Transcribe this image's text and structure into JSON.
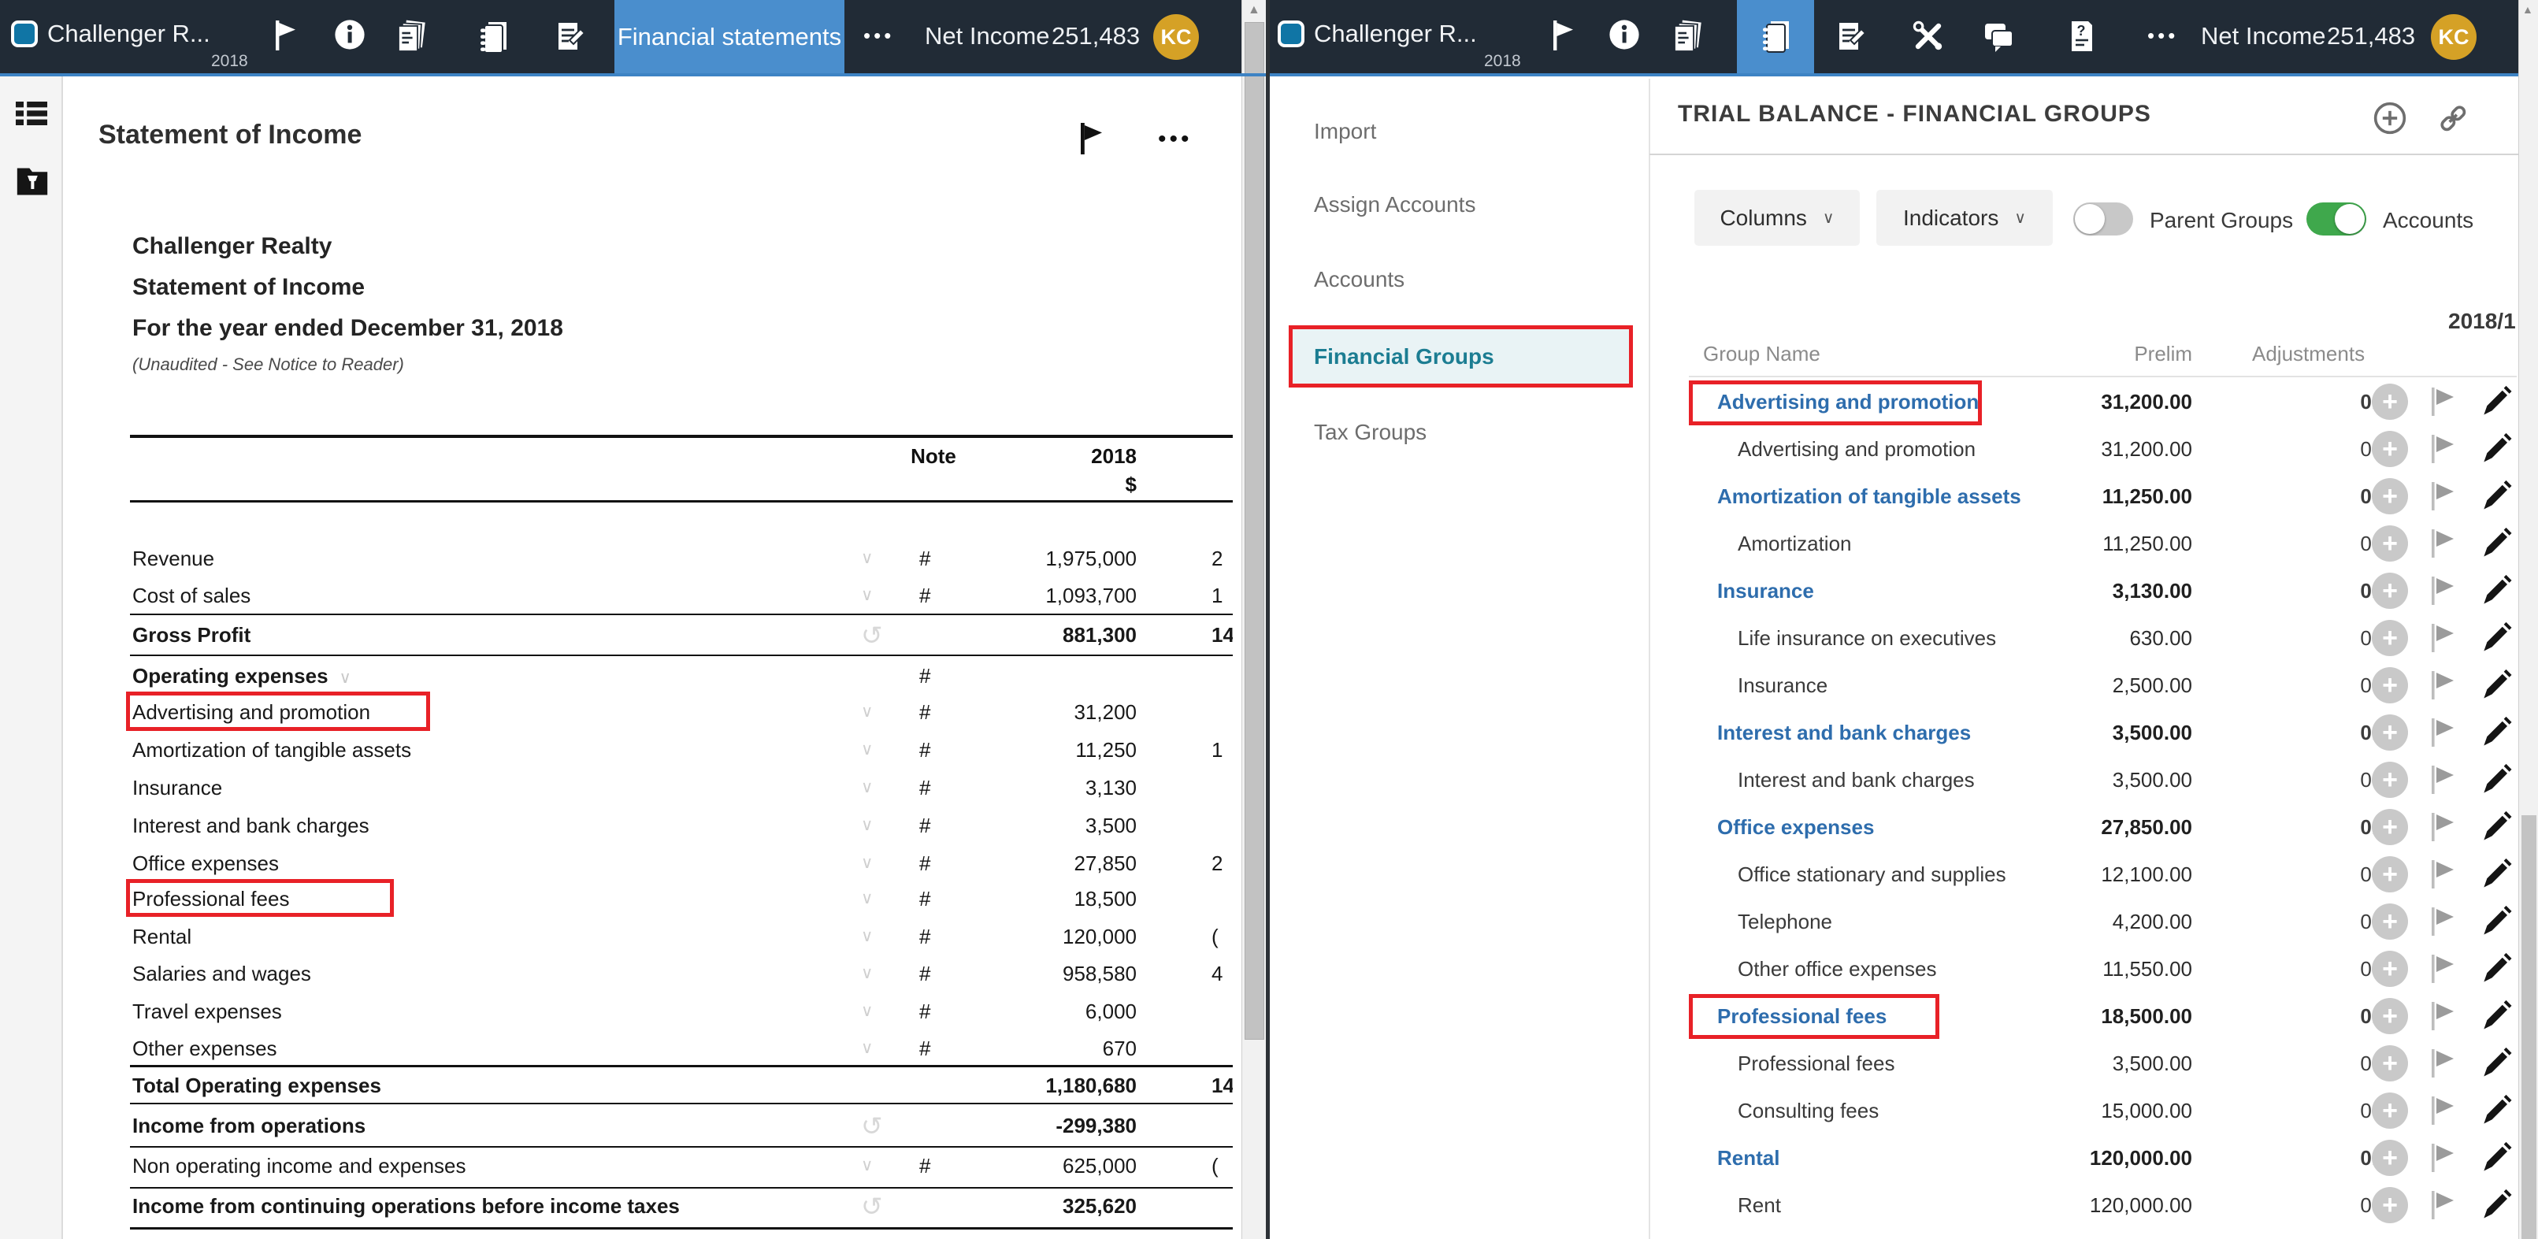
{
  "colors": {
    "header_bg": "#212b36",
    "accent_blue": "#4a8ecd",
    "border_blue": "#3d83c4",
    "avatar_gold": "#d5a126",
    "logo_teal": "#1075a5",
    "group_link_blue": "#2e6dad",
    "active_teal": "#1c7d92",
    "active_teal_bg": "#e9f3f5",
    "annotation_red": "#e82127",
    "toggle_green": "#3fa84c"
  },
  "left_window": {
    "header": {
      "app_title": "Challenger R...",
      "year": "2018",
      "tab": "Financial statements",
      "more": "•••",
      "net_income_label": "Net Income",
      "net_income_value": "251,483",
      "avatar_initials": "KC",
      "icons": [
        "flag-icon",
        "info-icon",
        "documents-icon",
        "notebook-icon",
        "annotation-icon"
      ]
    },
    "rail_icons": [
      "list-icon",
      "folder-pin-icon"
    ],
    "toolbar": {
      "more": "•••",
      "icons": [
        "flag-icon",
        "more-icon"
      ]
    },
    "document": {
      "page_title": "Statement of Income",
      "company": "Challenger Realty",
      "statement_title": "Statement of Income",
      "period": "For the year ended December 31, 2018",
      "disclaimer": "(Unaudited - See Notice to Reader)",
      "columns": {
        "note": "Note",
        "year": "2018",
        "currency": "$"
      },
      "rows": [
        {
          "label": "Revenue",
          "value": "1,975,000",
          "chevron": "col",
          "note": "#",
          "clipped": "2"
        },
        {
          "label": "Cost of sales",
          "value": "1,093,700",
          "chevron": "col",
          "note": "#",
          "clipped": "1"
        },
        {
          "label": "Gross Profit",
          "value": "881,300",
          "bold": true,
          "icon": "rotate",
          "clipped": "14"
        },
        {
          "label": "Operating expenses",
          "value": "",
          "bold": true,
          "chevron": "inline",
          "note": "#",
          "clipped": ""
        },
        {
          "label": "Advertising and promotion",
          "value": "31,200",
          "chevron": "col",
          "note": "#",
          "clipped": "",
          "boxed": true
        },
        {
          "label": "Amortization of tangible assets",
          "value": "11,250",
          "chevron": "col",
          "note": "#",
          "clipped": "1"
        },
        {
          "label": "Insurance",
          "value": "3,130",
          "chevron": "col",
          "note": "#",
          "clipped": ""
        },
        {
          "label": "Interest and bank charges",
          "value": "3,500",
          "chevron": "col",
          "note": "#",
          "clipped": ""
        },
        {
          "label": "Office expenses",
          "value": "27,850",
          "chevron": "col",
          "note": "#",
          "clipped": "2"
        },
        {
          "label": "Professional fees",
          "value": "18,500",
          "chevron": "col",
          "note": "#",
          "clipped": "",
          "boxed": true
        },
        {
          "label": "Rental",
          "value": "120,000",
          "chevron": "col",
          "note": "#",
          "clipped": "("
        },
        {
          "label": "Salaries and wages",
          "value": "958,580",
          "chevron": "col",
          "note": "#",
          "clipped": "4"
        },
        {
          "label": "Travel expenses",
          "value": "6,000",
          "chevron": "col",
          "note": "#",
          "clipped": ""
        },
        {
          "label": "Other expenses",
          "value": "670",
          "chevron": "col",
          "note": "#",
          "clipped": ""
        },
        {
          "label": "Total Operating expenses",
          "value": "1,180,680",
          "bold": true,
          "clipped": "14"
        },
        {
          "label": "Income from operations",
          "value": "-299,380",
          "bold": true,
          "icon": "rotate",
          "clipped": ""
        },
        {
          "label": "Non operating income and expenses",
          "value": "625,000",
          "chevron": "col",
          "note": "#",
          "clipped": "("
        },
        {
          "label": "Income from continuing operations before income taxes",
          "value": "325,620",
          "bold": true,
          "icon": "rotate",
          "clipped": ""
        }
      ]
    }
  },
  "right_window": {
    "header": {
      "app_title": "Challenger R...",
      "year": "2018",
      "more": "•••",
      "net_income_label": "Net Income",
      "net_income_value": "251,483",
      "avatar_initials": "KC",
      "icons": [
        "flag-icon",
        "info-icon",
        "documents-icon",
        "notebook-icon",
        "annotation-icon",
        "tools-icon",
        "chat-icon",
        "help-document-icon"
      ]
    },
    "sidebar": {
      "items": [
        "Import",
        "Assign Accounts",
        "Accounts",
        "Financial Groups",
        "Tax Groups"
      ],
      "active": "Financial Groups"
    },
    "main": {
      "title": "TRIAL BALANCE - FINANCIAL GROUPS",
      "header_icons": [
        "add-icon",
        "link-icon"
      ],
      "controls": {
        "columns": "Columns",
        "indicators": "Indicators",
        "parent_groups": "Parent Groups",
        "parent_groups_on": false,
        "accounts": "Accounts",
        "accounts_on": true
      },
      "period_label": "2018/1",
      "table": {
        "headers": [
          "Group Name",
          "Prelim",
          "Adjustments"
        ],
        "row_icons": [
          "add-circle-icon",
          "flag-icon",
          "edit-pencil-icon"
        ],
        "rows": [
          {
            "name": "Advertising and promotion",
            "level": "parent",
            "prelim": "31,200.00",
            "adjustments": "0.00",
            "boxed": true
          },
          {
            "name": "Advertising and promotion",
            "level": "child",
            "prelim": "31,200.00",
            "adjustments": "0.00"
          },
          {
            "name": "Amortization of tangible assets",
            "level": "parent",
            "prelim": "11,250.00",
            "adjustments": "0.00"
          },
          {
            "name": "Amortization",
            "level": "child",
            "prelim": "11,250.00",
            "adjustments": "0.00"
          },
          {
            "name": "Insurance",
            "level": "parent",
            "prelim": "3,130.00",
            "adjustments": "0.00"
          },
          {
            "name": "Life insurance on executives",
            "level": "child",
            "prelim": "630.00",
            "adjustments": "0.00"
          },
          {
            "name": "Insurance",
            "level": "child",
            "prelim": "2,500.00",
            "adjustments": "0.00"
          },
          {
            "name": "Interest and bank charges",
            "level": "parent",
            "prelim": "3,500.00",
            "adjustments": "0.00"
          },
          {
            "name": "Interest and bank charges",
            "level": "child",
            "prelim": "3,500.00",
            "adjustments": "0.00"
          },
          {
            "name": "Office expenses",
            "level": "parent",
            "prelim": "27,850.00",
            "adjustments": "0.00"
          },
          {
            "name": "Office stationary and supplies",
            "level": "child",
            "prelim": "12,100.00",
            "adjustments": "0.00"
          },
          {
            "name": "Telephone",
            "level": "child",
            "prelim": "4,200.00",
            "adjustments": "0.00"
          },
          {
            "name": "Other office expenses",
            "level": "child",
            "prelim": "11,550.00",
            "adjustments": "0.00"
          },
          {
            "name": "Professional fees",
            "level": "parent",
            "prelim": "18,500.00",
            "adjustments": "0.00",
            "boxed": true
          },
          {
            "name": "Professional fees",
            "level": "child",
            "prelim": "3,500.00",
            "adjustments": "0.00"
          },
          {
            "name": "Consulting fees",
            "level": "child",
            "prelim": "15,000.00",
            "adjustments": "0.00"
          },
          {
            "name": "Rental",
            "level": "parent",
            "prelim": "120,000.00",
            "adjustments": "0.00"
          },
          {
            "name": "Rent",
            "level": "child",
            "prelim": "120,000.00",
            "adjustments": "0.00"
          }
        ]
      }
    }
  }
}
